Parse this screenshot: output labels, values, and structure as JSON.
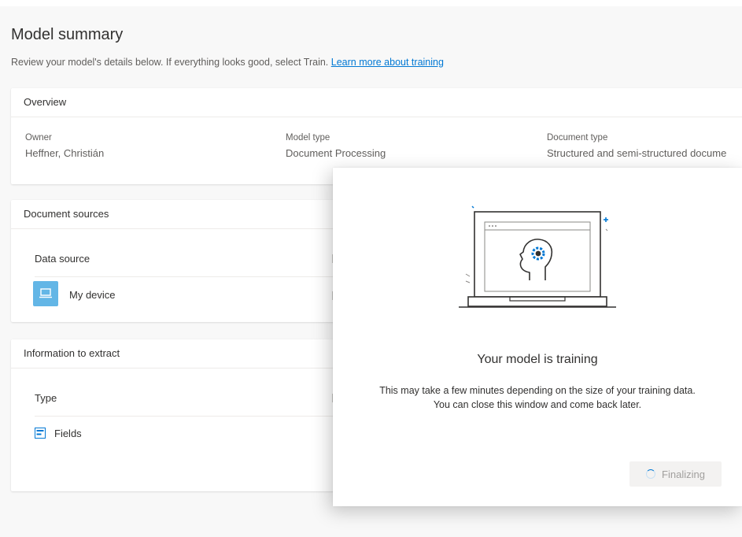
{
  "page": {
    "title": "Model summary",
    "subtitle": "Review your model's details below. If everything looks good, select Train.",
    "learn_more_link": "Learn more about training"
  },
  "overview": {
    "heading": "Overview",
    "owner_label": "Owner",
    "owner_value": "Heffner, Christián",
    "model_type_label": "Model type",
    "model_type_value": "Document Processing",
    "document_type_label": "Document type",
    "document_type_value": "Structured and semi-structured docume"
  },
  "document_sources": {
    "heading": "Document sources",
    "column_label": "Data source",
    "source_label": "My device"
  },
  "information_to_extract": {
    "heading": "Information to extract",
    "column_label": "Type",
    "type_label": "Fields"
  },
  "dialog": {
    "title": "Your model is training",
    "body_line1": "This may take a few minutes depending on the size of your training data.",
    "body_line2": "You can close this window and come back later.",
    "button_label": "Finalizing"
  },
  "icons": {
    "device": "laptop-icon",
    "fields": "abc-def-fields-icon",
    "spinner": "loading-spinner-icon",
    "illustration": "laptop-with-brain-gear-illustration"
  },
  "colors": {
    "accent": "#0078d4",
    "device_tile": "#63b6e6",
    "disabled_button_bg": "#f3f2f1",
    "disabled_button_text": "#a19f9d"
  }
}
